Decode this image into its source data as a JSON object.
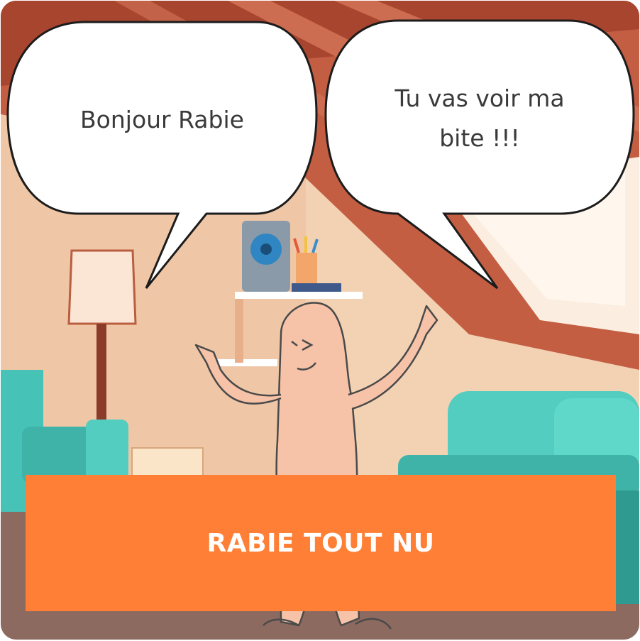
{
  "bubbles": {
    "left": {
      "text": "Bonjour Rabie"
    },
    "right": {
      "line1": "Tu vas voir ma",
      "line2": "bite !!!"
    }
  },
  "banner": {
    "title": "RABIE TOUT NU"
  },
  "colors": {
    "banner": "#fe7f35",
    "wall": "#f3d2b4",
    "ceiling": "#c25a3f",
    "sofa": "#46c2b6",
    "character": "#f7c3a8"
  }
}
